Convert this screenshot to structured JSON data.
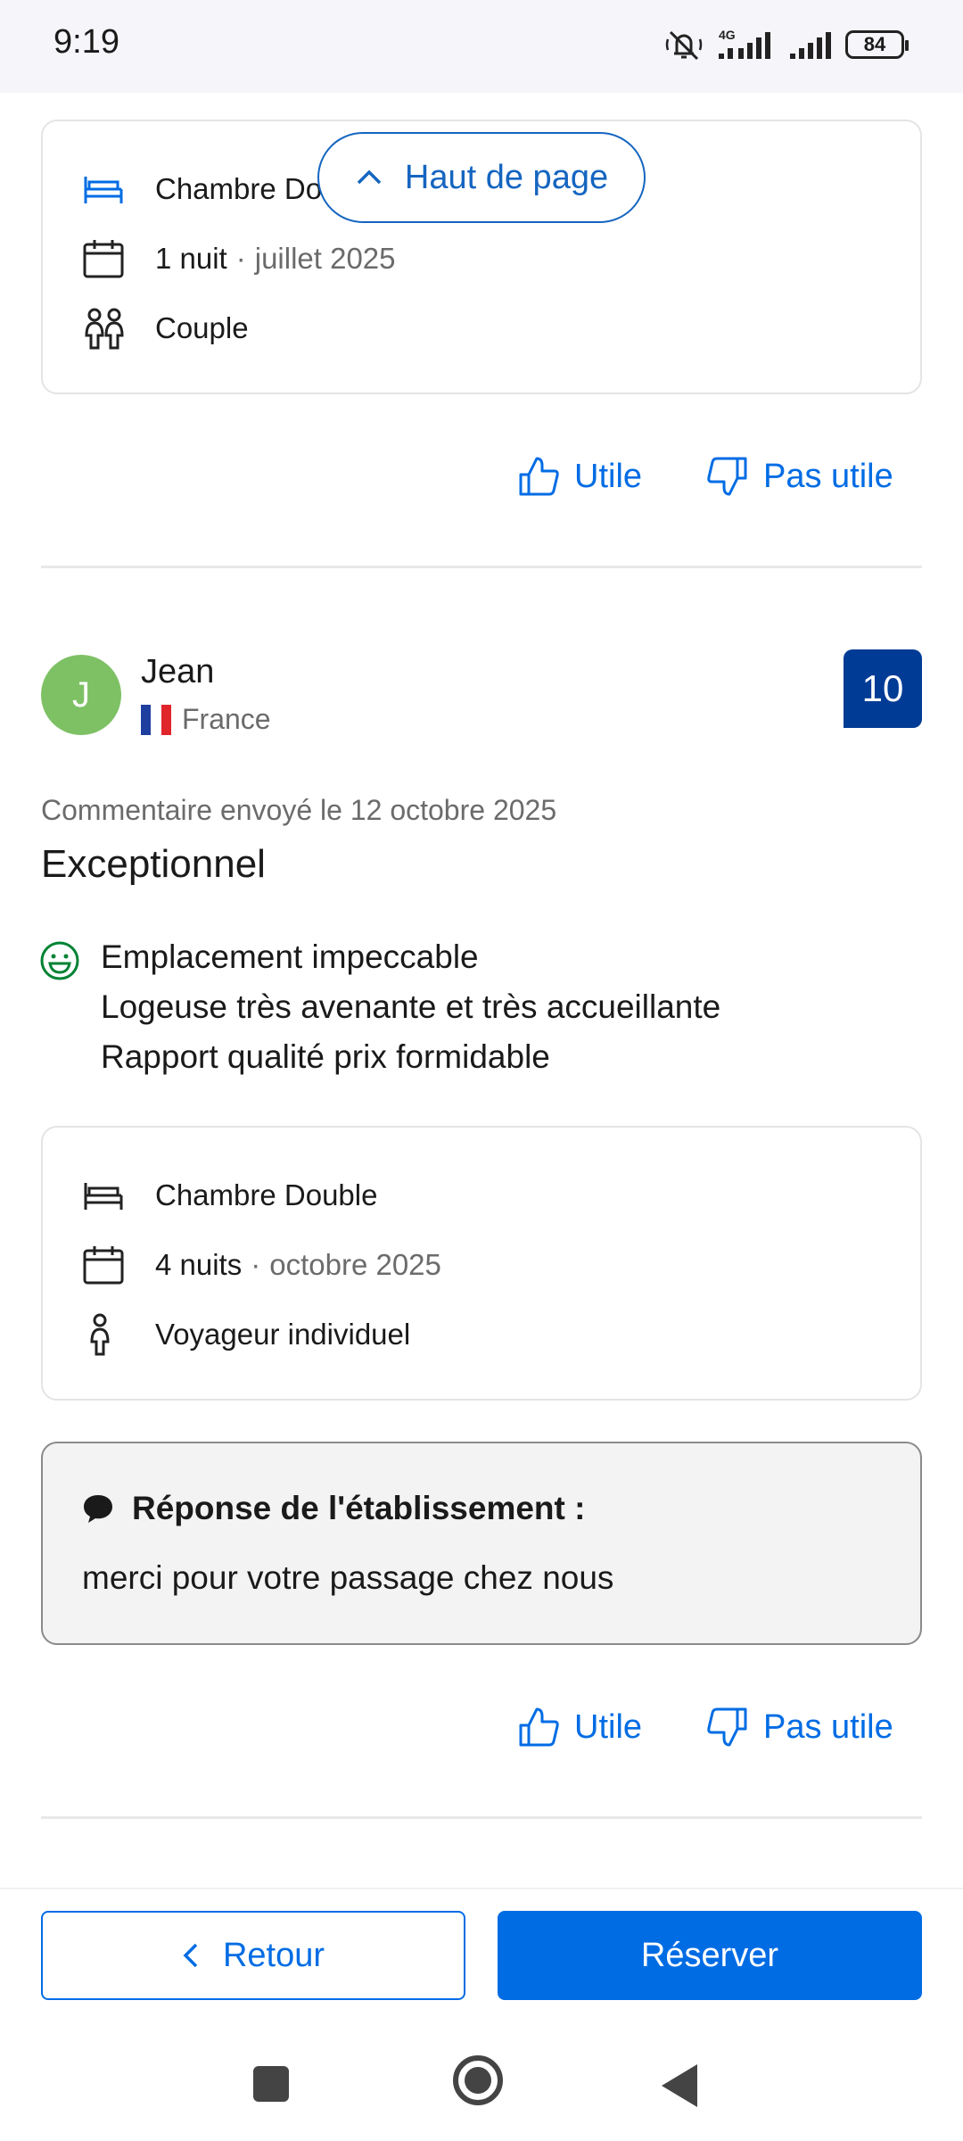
{
  "status_bar": {
    "time": "9:19",
    "network": "4G",
    "battery": "84"
  },
  "first_card": {
    "room": "Chambre Do",
    "nights": "1 nuit",
    "date": "juillet 2025",
    "traveler": "Couple"
  },
  "scroll_top": {
    "label": "Haut de page"
  },
  "first_feedback": {
    "useful": "Utile",
    "not_useful": "Pas utile"
  },
  "review": {
    "avatar_letter": "J",
    "name": "Jean",
    "country": "France",
    "score": "10",
    "date": "Commentaire envoyé le 12 octobre 2025",
    "title": "Exceptionnel",
    "positive_lines": [
      "Emplacement impeccable",
      "Logeuse très avenante et très accueillante",
      "Rapport qualité prix formidable"
    ],
    "room": "Chambre Double",
    "nights": "4 nuits",
    "stay_date": "octobre 2025",
    "traveler": "Voyageur individuel",
    "response_title": "Réponse de l'établissement :",
    "response_text": "merci pour votre passage chez nous",
    "useful": "Utile",
    "not_useful": "Pas utile"
  },
  "bottom_bar": {
    "back_label": "Retour",
    "book_label": "Réserver"
  },
  "colors": {
    "primary": "#006ce4",
    "score_bg": "#003b95",
    "avatar_bg": "#7ec165",
    "smiley": "#008234"
  },
  "icons": [
    "bed-icon",
    "calendar-icon",
    "couple-icon",
    "person-icon",
    "thumbs-up-icon",
    "thumbs-down-icon",
    "smiley-icon",
    "chat-bubble-icon",
    "chevron-up-icon",
    "chevron-left-icon"
  ]
}
